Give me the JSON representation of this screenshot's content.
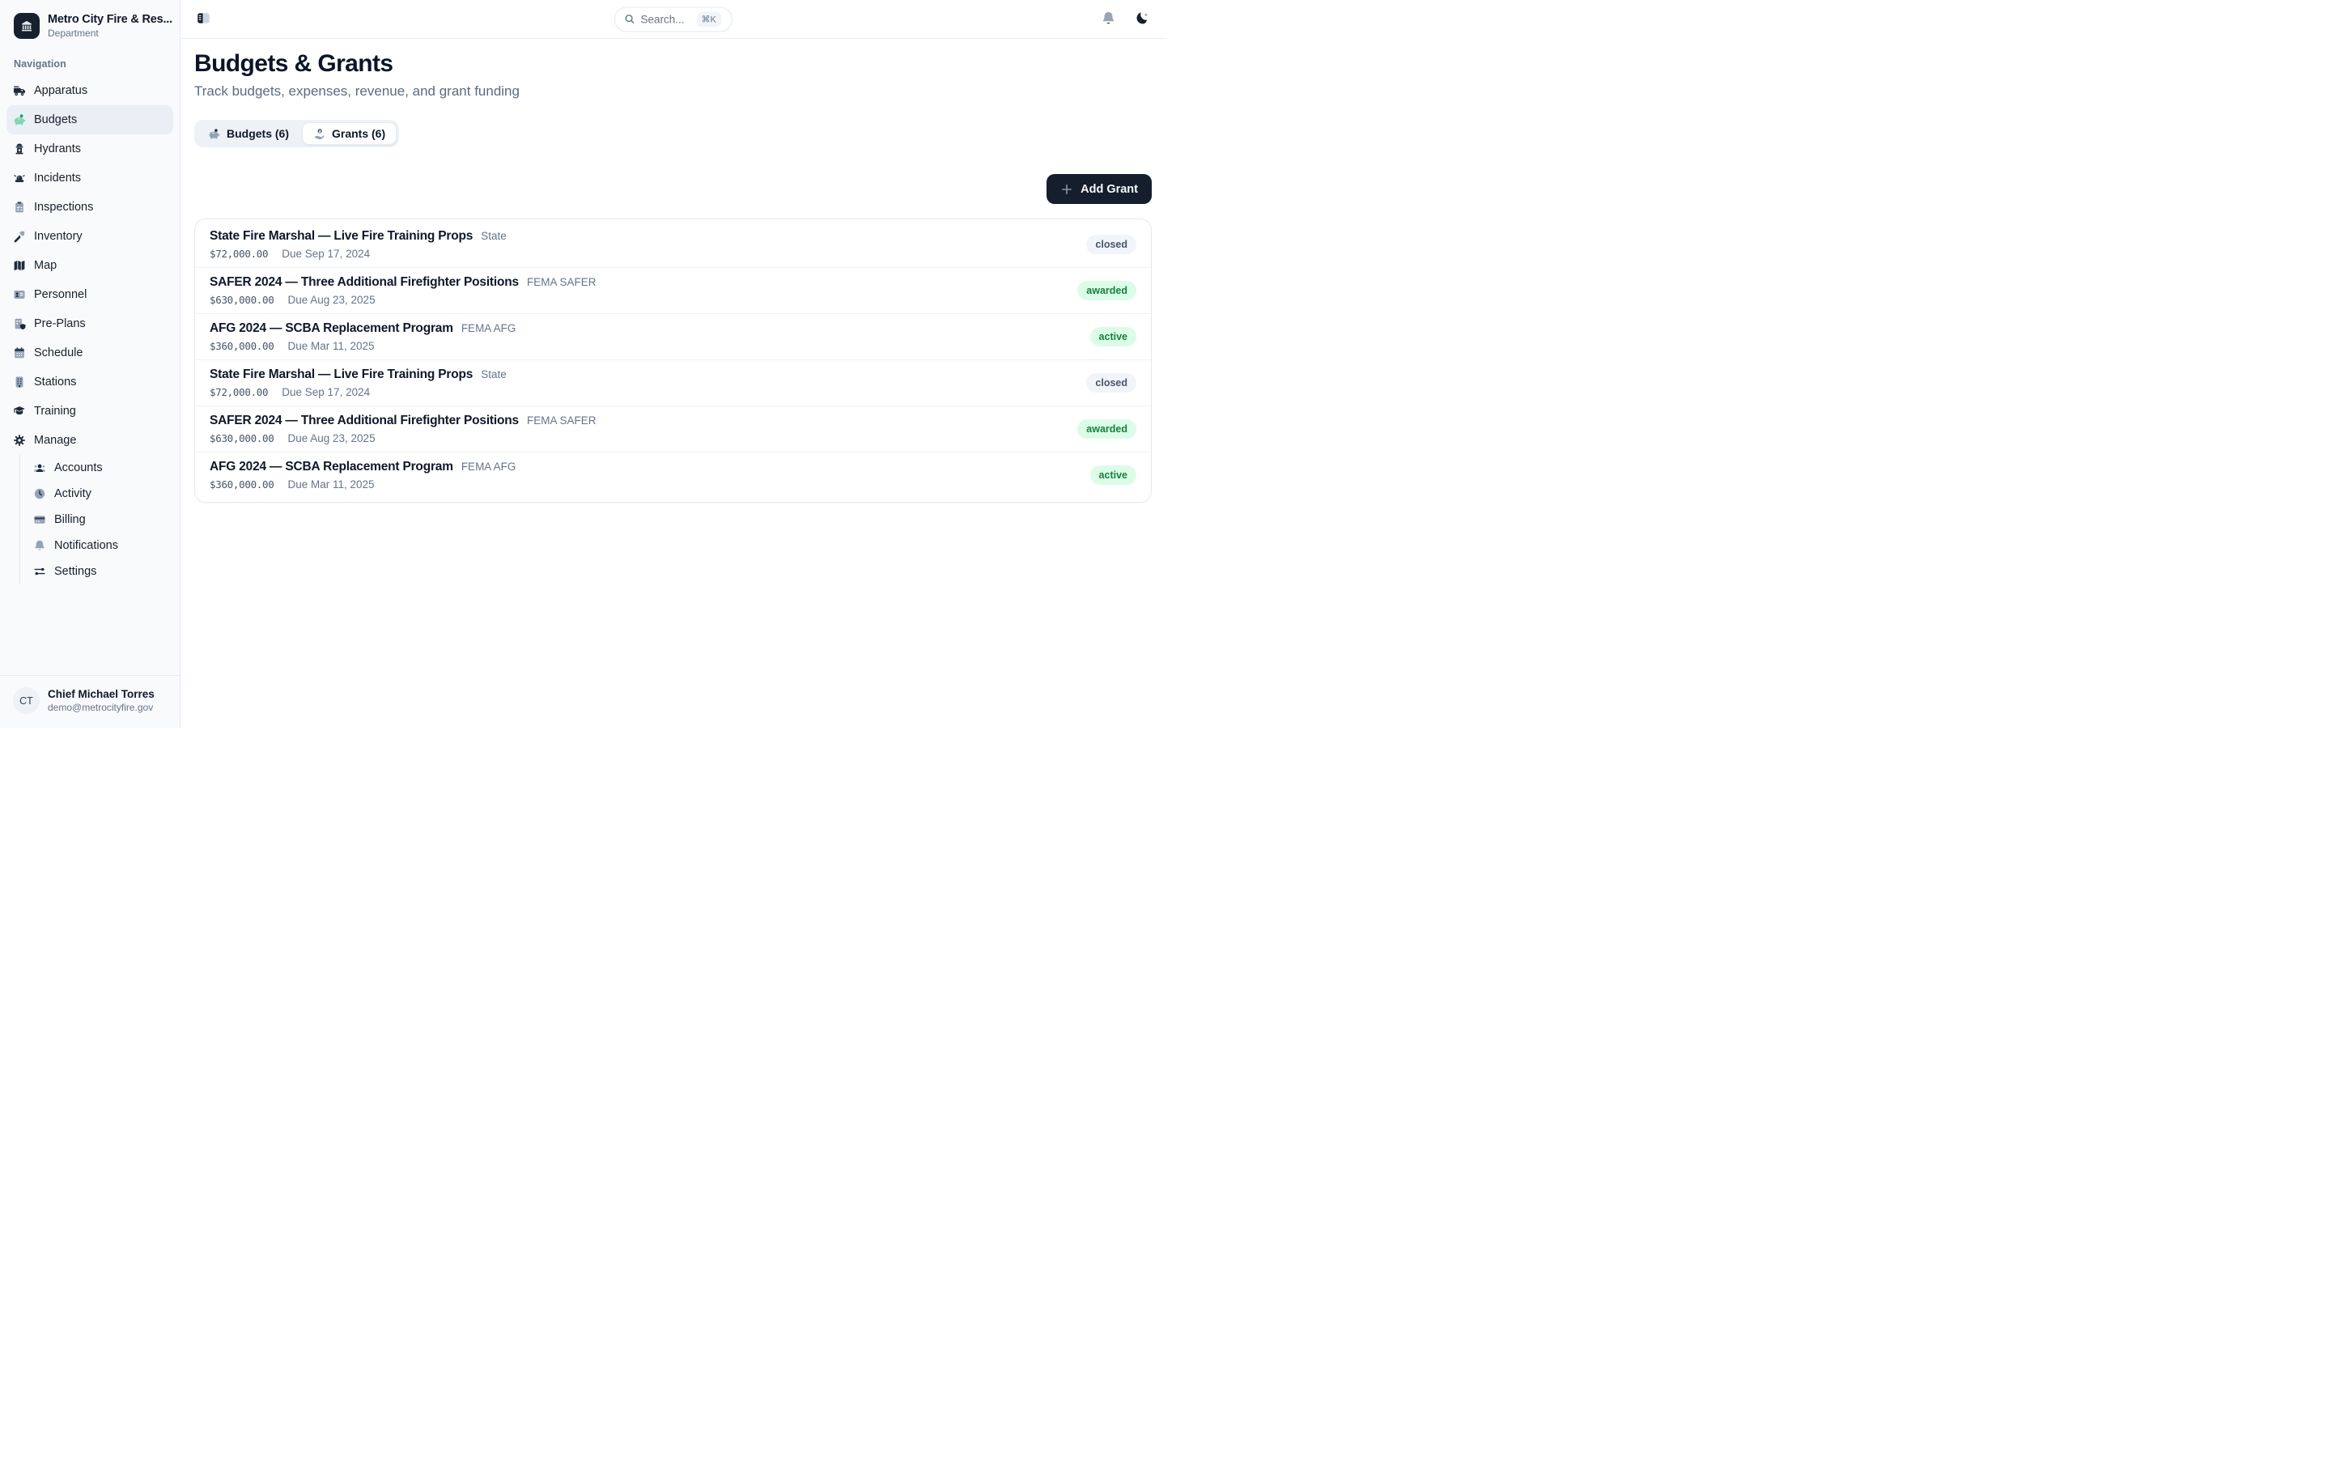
{
  "sidebar": {
    "org": {
      "name": "Metro City Fire & Res...",
      "type": "Department",
      "logo_icon": "landmark-icon"
    },
    "section_label": "Navigation",
    "items": [
      {
        "label": "Apparatus",
        "icon": "fire-truck-icon"
      },
      {
        "label": "Budgets",
        "icon": "piggy-bank-icon",
        "active": true
      },
      {
        "label": "Hydrants",
        "icon": "hydrant-icon"
      },
      {
        "label": "Incidents",
        "icon": "siren-icon"
      },
      {
        "label": "Inspections",
        "icon": "clipboard-check-icon"
      },
      {
        "label": "Inventory",
        "icon": "axe-icon"
      },
      {
        "label": "Map",
        "icon": "map-icon"
      },
      {
        "label": "Personnel",
        "icon": "id-card-icon"
      },
      {
        "label": "Pre-Plans",
        "icon": "building-shield-icon"
      },
      {
        "label": "Schedule",
        "icon": "calendar-icon"
      },
      {
        "label": "Stations",
        "icon": "building-icon"
      },
      {
        "label": "Training",
        "icon": "graduation-cap-icon"
      },
      {
        "label": "Manage",
        "icon": "gear-icon"
      }
    ],
    "manage_children": [
      {
        "label": "Accounts",
        "icon": "users-icon"
      },
      {
        "label": "Activity",
        "icon": "clock-icon"
      },
      {
        "label": "Billing",
        "icon": "credit-card-icon"
      },
      {
        "label": "Notifications",
        "icon": "bell-icon"
      },
      {
        "label": "Settings",
        "icon": "sliders-icon"
      }
    ],
    "user": {
      "initials": "CT",
      "name": "Chief Michael Torres",
      "email": "demo@metrocityfire.gov"
    }
  },
  "header": {
    "sidebar_toggle_icon": "panel-left-icon",
    "search": {
      "placeholder": "Search...",
      "shortcut": "⌘K",
      "icon": "magnifier-icon"
    },
    "notifications_icon": "bell-icon",
    "theme_toggle_icon": "moon-sparkle-icon"
  },
  "page": {
    "title": "Budgets & Grants",
    "subtitle": "Track budgets, expenses, revenue, and grant funding",
    "tabs": [
      {
        "label": "Budgets (6)",
        "icon": "piggy-bank-icon",
        "active": false
      },
      {
        "label": "Grants (6)",
        "icon": "hand-coin-icon",
        "active": true
      }
    ],
    "add_button": "Add Grant"
  },
  "grants": [
    {
      "name": "State Fire Marshal — Live Fire Training Props",
      "category": "State",
      "amount": "$72,000.00",
      "due": "Due Sep 17, 2024",
      "status": "closed"
    },
    {
      "name": "SAFER 2024 — Three Additional Firefighter Positions",
      "category": "FEMA SAFER",
      "amount": "$630,000.00",
      "due": "Due Aug 23, 2025",
      "status": "awarded"
    },
    {
      "name": "AFG 2024 — SCBA Replacement Program",
      "category": "FEMA AFG",
      "amount": "$360,000.00",
      "due": "Due Mar 11, 2025",
      "status": "active"
    },
    {
      "name": "State Fire Marshal — Live Fire Training Props",
      "category": "State",
      "amount": "$72,000.00",
      "due": "Due Sep 17, 2024",
      "status": "closed"
    },
    {
      "name": "SAFER 2024 — Three Additional Firefighter Positions",
      "category": "FEMA SAFER",
      "amount": "$630,000.00",
      "due": "Due Aug 23, 2025",
      "status": "awarded"
    },
    {
      "name": "AFG 2024 — SCBA Replacement Program",
      "category": "FEMA AFG",
      "amount": "$360,000.00",
      "due": "Due Mar 11, 2025",
      "status": "active"
    }
  ],
  "colors": {
    "accent_dark": "#141e2d",
    "sidebar_bg": "#f8fafc",
    "border": "#e5eaf0",
    "text_primary": "#0f172a",
    "text_muted": "#64748b",
    "badge_green_bg": "#dcfce7",
    "badge_green_text": "#15803d",
    "badge_gray_bg": "#f1f5f9",
    "badge_gray_text": "#475569",
    "piggy_green": "#85d4b2",
    "coin_green": "#10a35f"
  }
}
